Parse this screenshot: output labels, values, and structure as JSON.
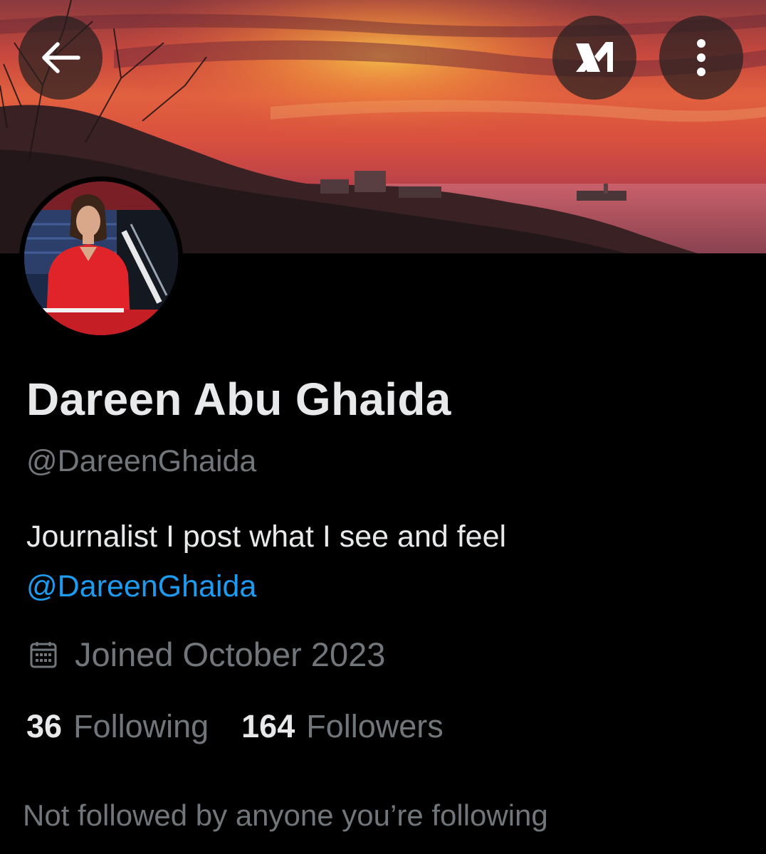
{
  "header": {
    "back_icon": "arrow-left-icon",
    "grok_icon": "grok-icon",
    "more_icon": "more-vertical-icon"
  },
  "profile": {
    "display_name": "Dareen Abu Ghaida",
    "handle": "@DareenGhaida",
    "bio_text": "Journalist I post what I see and feel",
    "bio_mention": "@DareenGhaida",
    "joined_icon": "calendar-icon",
    "joined": "Joined October 2023",
    "following_count": "36",
    "following_label": "Following",
    "followers_count": "164",
    "followers_label": "Followers",
    "followed_by_note": "Not followed by anyone you’re following"
  },
  "colors": {
    "background": "#000000",
    "primary_text": "#e7e9ea",
    "secondary_text": "#71767b",
    "link": "#1d9bf0"
  }
}
